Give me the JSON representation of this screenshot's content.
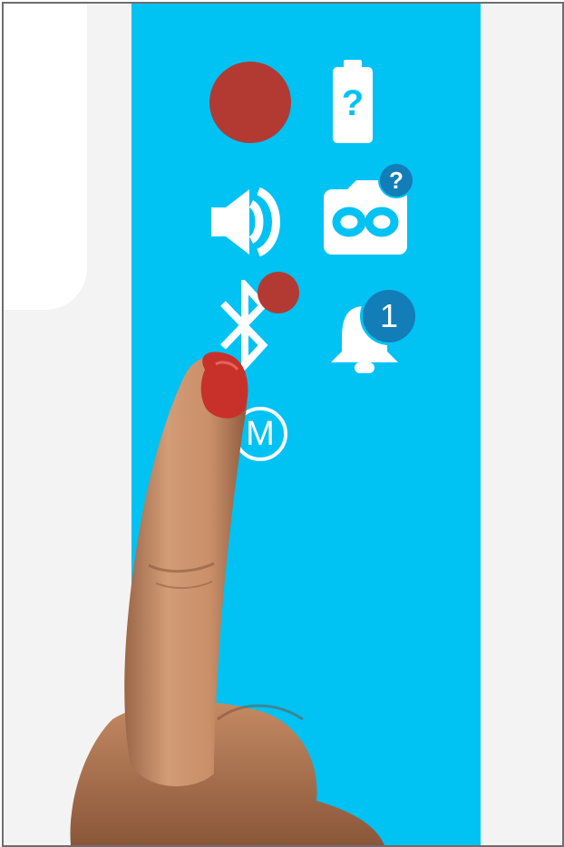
{
  "colors": {
    "panel": "#00c2f3",
    "background": "#f3f3f3",
    "record_dot": "#b23a33",
    "badge": "#137db8",
    "icon": "#ffffff"
  },
  "icons": [
    "record-icon",
    "battery-unknown-icon",
    "volume-icon",
    "camera-loop-icon",
    "bluetooth-icon",
    "bell-icon",
    "mode-m-icon"
  ],
  "battery": {
    "glyph": "?"
  },
  "camera": {
    "badge": "?"
  },
  "notifications": {
    "badge": "1"
  },
  "mode": {
    "label": "M"
  }
}
